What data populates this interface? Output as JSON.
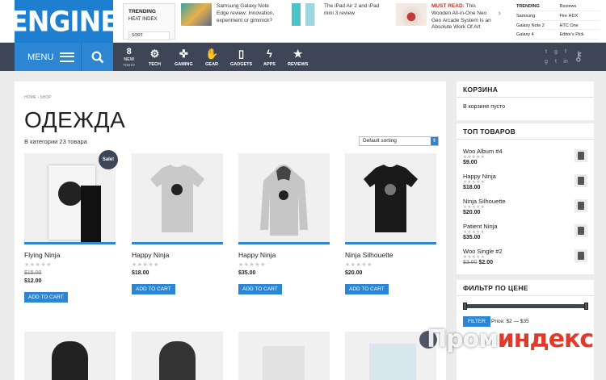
{
  "logo": "ENGINE",
  "trending": {
    "title": "TRENDING",
    "sub": "HEAT INDEX",
    "sort": "SORT"
  },
  "top_stories": [
    {
      "text": "Samsung Galaxy Note Edge review: Innovation, experiment or gimmick?"
    },
    {
      "text": "The iPad Air 2 and iPad mini 3 review"
    },
    {
      "prefix": "MUST READ:",
      "text": " This Wooden All-in-One Neo Geo Arcade System Is an Absolute Work Of Art"
    }
  ],
  "ticker": [
    "TRENDING",
    "Reviews",
    "Samsung",
    "Fire HDX",
    "Galaxy Note 2",
    "HTC One",
    "Galaxy 4",
    "Editor's Pick"
  ],
  "nav": {
    "menu": "MENU",
    "new_count": "8",
    "new_label": "NEW",
    "new_sub": "TODAY",
    "items": [
      {
        "label": "TECH",
        "icon": "gear-icon",
        "glyph": "⚙"
      },
      {
        "label": "GAMING",
        "icon": "gamepad-icon",
        "glyph": "✜"
      },
      {
        "label": "GEAR",
        "icon": "hand-icon",
        "glyph": "✋"
      },
      {
        "label": "GADGETS",
        "icon": "phone-icon",
        "glyph": "▯"
      },
      {
        "label": "APPS",
        "icon": "bolt-icon",
        "glyph": "ϟ"
      },
      {
        "label": "REVIEWS",
        "icon": "star-icon",
        "glyph": "★"
      }
    ],
    "social": [
      "t",
      "g",
      "f",
      "g",
      "t",
      "in"
    ]
  },
  "breadcrumb": "HOME  ›  SHOP",
  "page_title": "ОДЕЖДА",
  "result_count": "В категории 23 товара",
  "sort_value": "Default sorting",
  "products": [
    {
      "name": "Flying Ninja",
      "old_price": "$15.00",
      "price": "$12.00",
      "button": "ADD TO CART",
      "sale": "Sale!"
    },
    {
      "name": "Happy Ninja",
      "price": "$18.00",
      "button": "ADD TO CART"
    },
    {
      "name": "Happy Ninja",
      "price": "$35.00",
      "button": "ADD TO CART"
    },
    {
      "name": "Ninja Silhouette",
      "price": "$20.00",
      "button": "ADD TO CART"
    }
  ],
  "sidebar": {
    "cart_title": "КОРЗИНА",
    "cart_empty": "В корзине пусто",
    "top_title": "ТОП ТОВАРОВ",
    "top": [
      {
        "name": "Woo Album #4",
        "price": "$9.00"
      },
      {
        "name": "Happy Ninja",
        "price": "$18.00"
      },
      {
        "name": "Ninja Silhouette",
        "price": "$20.00"
      },
      {
        "name": "Patient Ninja",
        "price": "$35.00"
      },
      {
        "name": "Woo Single #2",
        "old_price": "$3.00",
        "price": "$2.00"
      }
    ],
    "filter_title": "ФИЛЬТР ПО ЦЕНЕ",
    "filter_button": "FILTER",
    "filter_range": "Price: $2 — $35"
  },
  "watermark": {
    "a": "Пром",
    "b": "индекс"
  },
  "colors": {
    "accent": "#2d86d4",
    "nav": "#3d4656"
  }
}
